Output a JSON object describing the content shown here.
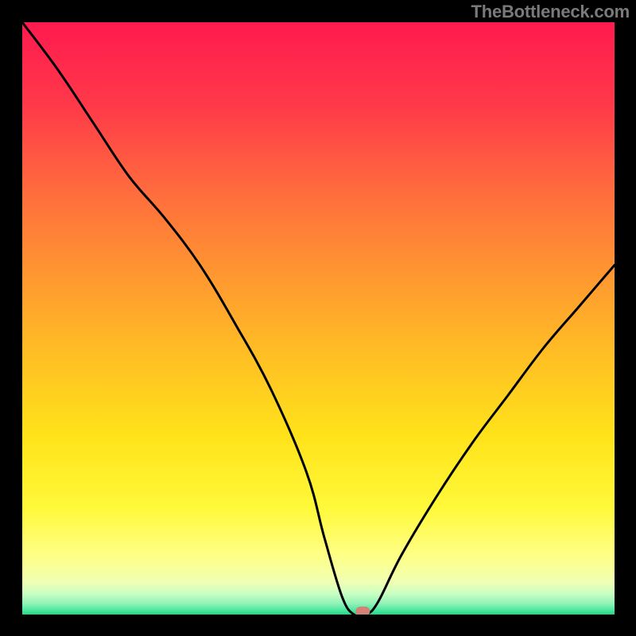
{
  "watermark": "TheBottleneck.com",
  "chart_data": {
    "type": "line",
    "title": "",
    "xlabel": "",
    "ylabel": "",
    "xlim": [
      0,
      100
    ],
    "ylim": [
      0,
      100
    ],
    "x": [
      0,
      6,
      12,
      18,
      24,
      30,
      36,
      42,
      48,
      51,
      54,
      56,
      58,
      60,
      64,
      70,
      76,
      82,
      88,
      94,
      100
    ],
    "values": [
      100,
      92,
      83,
      74,
      67,
      59,
      49,
      38,
      24,
      13,
      3,
      0,
      0,
      2,
      10,
      20,
      29,
      37,
      45,
      52,
      59
    ],
    "marker": {
      "x": 57.5,
      "y": 0
    },
    "gradient_bands": [
      {
        "offset": 0.0,
        "color": "#ff1a4f"
      },
      {
        "offset": 0.14,
        "color": "#ff3949"
      },
      {
        "offset": 0.28,
        "color": "#ff6a3e"
      },
      {
        "offset": 0.42,
        "color": "#ff9531"
      },
      {
        "offset": 0.56,
        "color": "#ffbe24"
      },
      {
        "offset": 0.7,
        "color": "#ffe31a"
      },
      {
        "offset": 0.82,
        "color": "#fff93a"
      },
      {
        "offset": 0.9,
        "color": "#ffff86"
      },
      {
        "offset": 0.945,
        "color": "#f0ffb2"
      },
      {
        "offset": 0.965,
        "color": "#c9ffc3"
      },
      {
        "offset": 0.982,
        "color": "#8ff2b7"
      },
      {
        "offset": 0.992,
        "color": "#4fe8a0"
      },
      {
        "offset": 1.0,
        "color": "#1fd885"
      }
    ],
    "marker_color": "#d48176",
    "curve_color": "#000000"
  }
}
